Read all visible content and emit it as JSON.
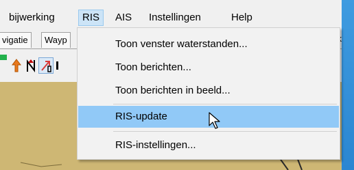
{
  "menubar": {
    "items": [
      "bijwerking",
      "RIS",
      "AIS",
      "Instellingen",
      "Help"
    ],
    "active": "RIS"
  },
  "tabs": {
    "left": [
      "vigatie",
      "Wayp"
    ],
    "right": "erk"
  },
  "toolbar": {
    "icons": [
      "green-status-icon",
      "orange-up-arrow-icon",
      "north-arrow-icon",
      "route-arrow-icon"
    ]
  },
  "dropdown": {
    "items": [
      {
        "label": "Toon venster waterstanden...",
        "highlighted": false
      },
      {
        "label": "Toon berichten...",
        "highlighted": false
      },
      {
        "label": "Toon berichten in beeld...",
        "highlighted": false
      },
      {
        "label": "RIS-update",
        "highlighted": true
      },
      {
        "label": "RIS-instellingen...",
        "highlighted": false
      }
    ]
  },
  "colors": {
    "menu_active": "#cce4f7",
    "highlight": "#91c9f7",
    "map": "#ceb774",
    "desktop": "#2e8fd8"
  }
}
